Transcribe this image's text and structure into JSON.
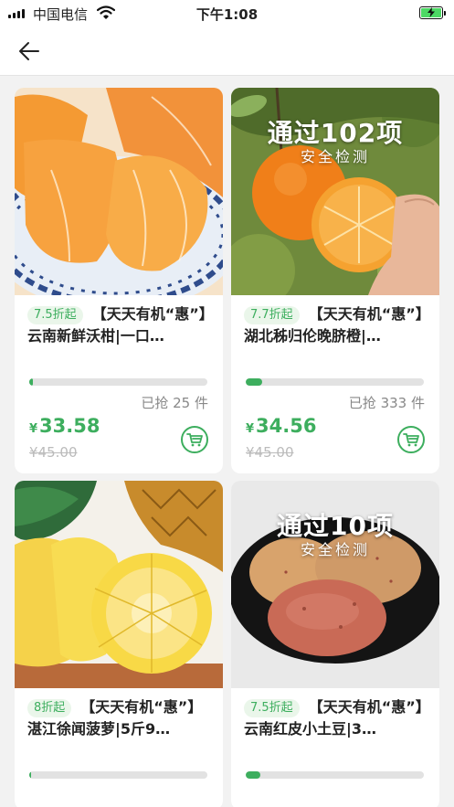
{
  "status_bar": {
    "carrier": "中国电信",
    "time": "下午1:08"
  },
  "nav": {
    "back_icon": "arrow-left-icon"
  },
  "colors": {
    "accent": "#3dae5e",
    "discount_bg": "#eaf6ea",
    "price_old": "#bbbbbb"
  },
  "products": [
    {
      "discount": "7.5折起",
      "title": "【天天有机“惠”】云南新鲜沃柑|一口…",
      "sold_prefix": "已抢",
      "sold_count": "25",
      "sold_unit": "件",
      "progress": 0.02,
      "currency": "¥",
      "price": "33.58",
      "original_price": "¥45.00",
      "image_overlay_big": "",
      "image_overlay_small": ""
    },
    {
      "discount": "7.7折起",
      "title": "【天天有机“惠”】湖北秭归伦晚脐橙|…",
      "sold_prefix": "已抢",
      "sold_count": "333",
      "sold_unit": "件",
      "progress": 0.09,
      "currency": "¥",
      "price": "34.56",
      "original_price": "¥45.00",
      "image_overlay_big": "通过102项",
      "image_overlay_small": "安全检测"
    },
    {
      "discount": "8折起",
      "title": "【天天有机“惠”】湛江徐闻菠萝|5斤9…",
      "sold_prefix": "",
      "sold_count": "",
      "sold_unit": "",
      "progress": 0.01,
      "currency": "",
      "price": "",
      "original_price": "",
      "image_overlay_big": "",
      "image_overlay_small": ""
    },
    {
      "discount": "7.5折起",
      "title": "【天天有机“惠”】云南红皮小土豆|3…",
      "sold_prefix": "",
      "sold_count": "",
      "sold_unit": "",
      "progress": 0.08,
      "currency": "",
      "price": "",
      "original_price": "",
      "image_overlay_big": "通过10项",
      "image_overlay_small": "安全检测"
    }
  ]
}
